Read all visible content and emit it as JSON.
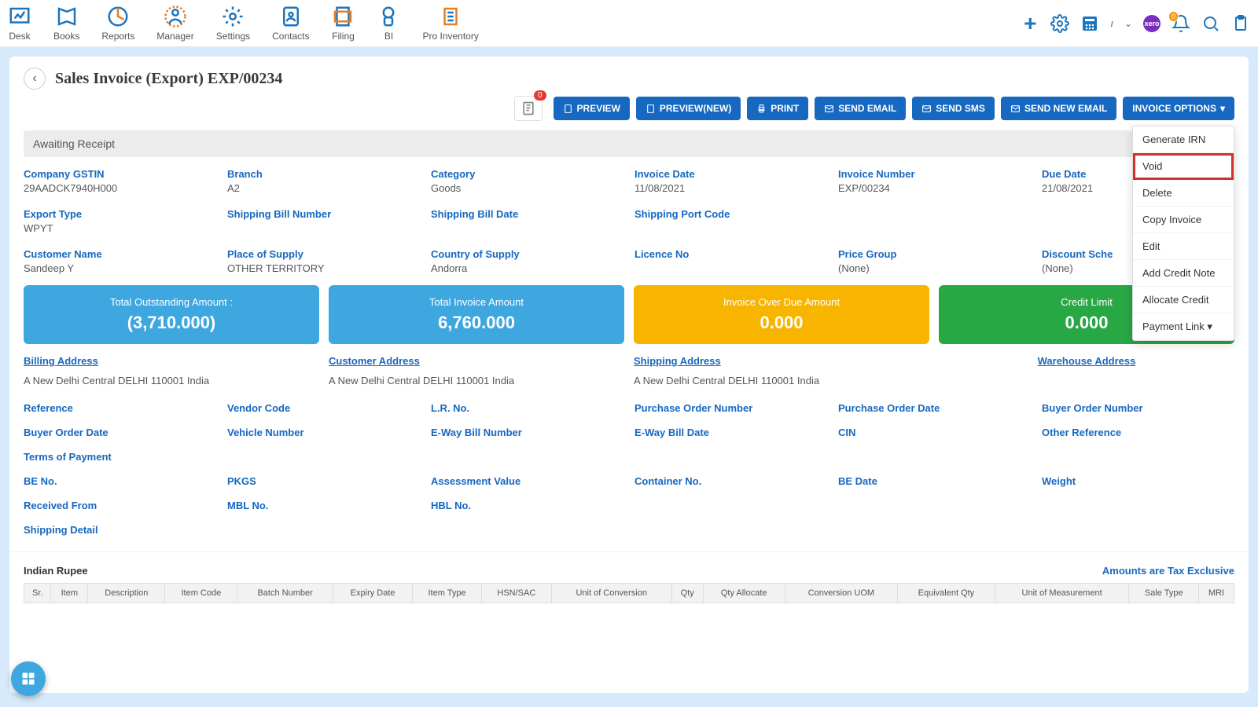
{
  "nav": [
    "Desk",
    "Books",
    "Reports",
    "Manager",
    "Settings",
    "Contacts",
    "Filing",
    "BI",
    "Pro Inventory"
  ],
  "page_title": "Sales Invoice (Export) EXP/00234",
  "badge_count": "0",
  "toolbar": {
    "preview": "PREVIEW",
    "preview_new": "PREVIEW(NEW)",
    "print": "PRINT",
    "send_email": "SEND EMAIL",
    "send_sms": "SEND SMS",
    "send_new_email": "SEND NEW EMAIL",
    "invoice_options": "INVOICE OPTIONS"
  },
  "options_menu": [
    "Generate IRN",
    "Void",
    "Delete",
    "Copy Invoice",
    "Edit",
    "Add Credit Note",
    "Allocate Credit",
    "Payment Link"
  ],
  "status": "Awaiting Receipt",
  "meta": {
    "company_gstin_l": "Company GSTIN",
    "company_gstin_v": "29AADCK7940H000",
    "branch_l": "Branch",
    "branch_v": "A2",
    "category_l": "Category",
    "category_v": "Goods",
    "invoice_date_l": "Invoice Date",
    "invoice_date_v": "11/08/2021",
    "invoice_number_l": "Invoice Number",
    "invoice_number_v": "EXP/00234",
    "due_date_l": "Due Date",
    "due_date_v": "21/08/2021",
    "export_type_l": "Export Type",
    "export_type_v": "WPYT",
    "ship_bill_no_l": "Shipping Bill Number",
    "ship_bill_date_l": "Shipping Bill Date",
    "ship_port_l": "Shipping Port Code",
    "customer_name_l": "Customer Name",
    "customer_name_v": "Sandeep Y",
    "place_supply_l": "Place of Supply",
    "place_supply_v": "OTHER TERRITORY",
    "country_supply_l": "Country of Supply",
    "country_supply_v": "Andorra",
    "licence_l": "Licence No",
    "price_group_l": "Price Group",
    "price_group_v": "(None)",
    "discount_l": "Discount Sche",
    "discount_v": "(None)"
  },
  "cards": {
    "out_l": "Total Outstanding Amount :",
    "out_v": "(3,710.000)",
    "inv_l": "Total Invoice Amount",
    "inv_v": "6,760.000",
    "over_l": "Invoice Over Due Amount",
    "over_v": "0.000",
    "credit_l": "Credit Limit",
    "credit_v": "0.000"
  },
  "addr": {
    "billing_l": "Billing Address",
    "customer_l": "Customer Address",
    "shipping_l": "Shipping Address",
    "warehouse_l": "Warehouse Address",
    "line": "A New Delhi Central DELHI 110001 India"
  },
  "refs": [
    "Reference",
    "Vendor Code",
    "L.R. No.",
    "Purchase Order Number",
    "Purchase Order Date",
    "Buyer Order Number",
    "Buyer Order Date",
    "Vehicle Number",
    "E-Way Bill Number",
    "E-Way Bill Date",
    "CIN",
    "Other Reference",
    "Terms of Payment",
    "",
    "",
    "",
    "",
    "",
    "BE No.",
    "PKGS",
    "Assessment Value",
    "Container No.",
    "BE Date",
    "Weight",
    "Received From",
    "MBL No.",
    "HBL No.",
    "",
    "",
    "",
    "Shipping Detail",
    "",
    "",
    "",
    "",
    ""
  ],
  "currency_line": "Indian Rupee",
  "tax_line": "Amounts are Tax Exclusive",
  "cols": [
    "Sr.",
    "Item",
    "Description",
    "Item Code",
    "Batch Number",
    "Expiry Date",
    "Item Type",
    "HSN/SAC",
    "Unit of Conversion",
    "Qty",
    "Qty Allocate",
    "Conversion UOM",
    "Equivalent Qty",
    "Unit of Measurement",
    "Sale Type",
    "MRI"
  ],
  "bell_count": "0",
  "caret": "▾"
}
